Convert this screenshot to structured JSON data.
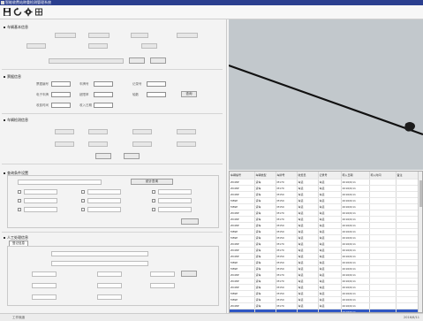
{
  "window": {
    "title": "智能收费站称重检测管理系统"
  },
  "toolbar": {
    "buttons": [
      {
        "icon": "save-icon"
      },
      {
        "icon": "refresh-icon"
      },
      {
        "icon": "settings-icon"
      },
      {
        "icon": "grid-icon"
      }
    ]
  },
  "sections": {
    "vehicle_basic": {
      "title": "车辆基本信息"
    },
    "ticket": {
      "title": "票据信息",
      "labels": [
        "票据编号",
        "车牌号",
        "记录号",
        "电子车牌",
        "超限率",
        "轴数",
        "收费时间",
        "收入日期"
      ],
      "button": "查询"
    },
    "inspect": {
      "title": "车辆检测信息"
    },
    "filter": {
      "title": "查询条件设置",
      "button": "统计查询"
    },
    "manual": {
      "title": "人工处理信息",
      "tab": "登记信息"
    }
  },
  "table": {
    "columns": [
      "车辆编号",
      "车辆类型",
      "车牌号",
      "收费员",
      "记录号",
      "称入日期",
      "称入时间",
      "备注"
    ],
    "rows": [
      [
        "Z048P",
        "货车",
        "M170",
        "车道",
        "车道",
        "2016/6/11",
        "",
        ""
      ],
      [
        "Z048P",
        "货车",
        "M170",
        "车道",
        "车道",
        "2016/6/11",
        "",
        ""
      ],
      [
        "Z048P",
        "货车",
        "M150",
        "车道",
        "车道",
        "2016/6/11",
        "",
        ""
      ],
      [
        "M89P",
        "货车",
        "M150",
        "车道",
        "车道",
        "2016/6/11",
        "",
        ""
      ],
      [
        "M89P",
        "货车",
        "M150",
        "车道",
        "车道",
        "2016/6/11",
        "",
        ""
      ],
      [
        "Z048P",
        "货车",
        "M170",
        "车道",
        "车道",
        "2016/6/11",
        "",
        ""
      ],
      [
        "Z048P",
        "货车",
        "M170",
        "车道",
        "车道",
        "2016/6/11",
        "",
        ""
      ],
      [
        "Z048P",
        "货车",
        "M150",
        "车道",
        "车道",
        "2016/6/11",
        "",
        ""
      ],
      [
        "M89P",
        "货车",
        "M150",
        "车道",
        "车道",
        "2016/6/11",
        "",
        ""
      ],
      [
        "M89P",
        "货车",
        "M150",
        "车道",
        "车道",
        "2016/6/11",
        "",
        ""
      ],
      [
        "Z048P",
        "货车",
        "M170",
        "车道",
        "车道",
        "2016/6/11",
        "",
        ""
      ],
      [
        "Z048P",
        "货车",
        "M170",
        "车道",
        "车道",
        "2016/6/11",
        "",
        ""
      ],
      [
        "Z048P",
        "货车",
        "M150",
        "车道",
        "车道",
        "2016/6/11",
        "",
        ""
      ],
      [
        "M89P",
        "货车",
        "M150",
        "车道",
        "车道",
        "2016/6/11",
        "",
        ""
      ],
      [
        "M89P",
        "货车",
        "M150",
        "车道",
        "车道",
        "2016/6/11",
        "",
        ""
      ],
      [
        "Z048P",
        "货车",
        "M170",
        "车道",
        "车道",
        "2016/6/11",
        "",
        ""
      ],
      [
        "Z048P",
        "货车",
        "M170",
        "车道",
        "车道",
        "2016/6/11",
        "",
        ""
      ],
      [
        "Z048P",
        "货车",
        "M150",
        "车道",
        "车道",
        "2016/6/11",
        "",
        ""
      ],
      [
        "M89P",
        "货车",
        "M150",
        "车道",
        "车道",
        "2016/6/11",
        "",
        ""
      ],
      [
        "M89P",
        "货车",
        "M150",
        "车道",
        "车道",
        "2016/6/11",
        "",
        ""
      ],
      [
        "Z048P",
        "货车",
        "M170",
        "车道",
        "车道",
        "2016/6/11",
        "",
        ""
      ]
    ],
    "selected_row": [
      "",
      "",
      "",
      "",
      "",
      "2016/6/11",
      "",
      ""
    ]
  },
  "status": {
    "left": "工作就绪",
    "right": "2016/6/11"
  },
  "colors": {
    "titlebar": "#2b3f8f",
    "selection": "#2f57c4",
    "video_bg": "#c2c8cc"
  }
}
